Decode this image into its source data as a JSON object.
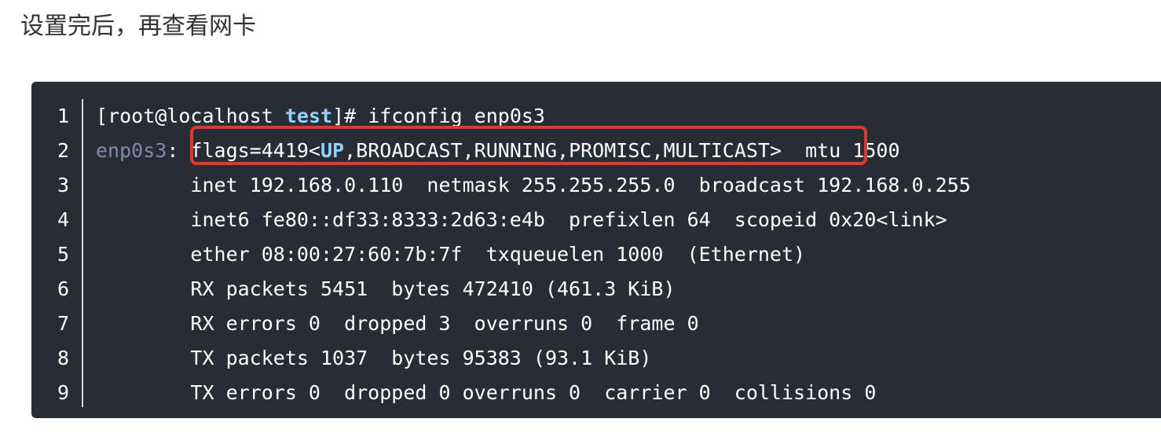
{
  "intro_text": "设置完后，再查看网卡",
  "code": {
    "line_numbers": [
      "1",
      "2",
      "3",
      "4",
      "5",
      "6",
      "7",
      "8",
      "9"
    ],
    "line1": {
      "prompt_before": "[root@localhost ",
      "prompt_dir": "test",
      "prompt_after": "]# ifconfig enp0s3"
    },
    "line2": {
      "iface": "enp0s3",
      "colon": ": ",
      "flags_before": "flags=4419<",
      "flags_up": "UP",
      "flags_after": ",BROADCAST,RUNNING,PROMISC,MULTICAST>",
      "mtu": "  mtu 1500"
    },
    "line3": "        inet 192.168.0.110  netmask 255.255.255.0  broadcast 192.168.0.255",
    "line4": "        inet6 fe80::df33:8333:2d63:e4b  prefixlen 64  scopeid 0x20<link>",
    "line5": "        ether 08:00:27:60:7b:7f  txqueuelen 1000  (Ethernet)",
    "line6": "        RX packets 5451  bytes 472410 (461.3 KiB)",
    "line7": "        RX errors 0  dropped 3  overruns 0  frame 0",
    "line8": "        TX packets 1037  bytes 95383 (93.1 KiB)",
    "line9": "        TX errors 0  dropped 0 overruns 0  carrier 0  collisions 0"
  },
  "colors": {
    "background": "#282c34",
    "highlight_border": "#e0382c",
    "keyword": "#8fd4ff",
    "interface_name": "#7f8cb0"
  }
}
